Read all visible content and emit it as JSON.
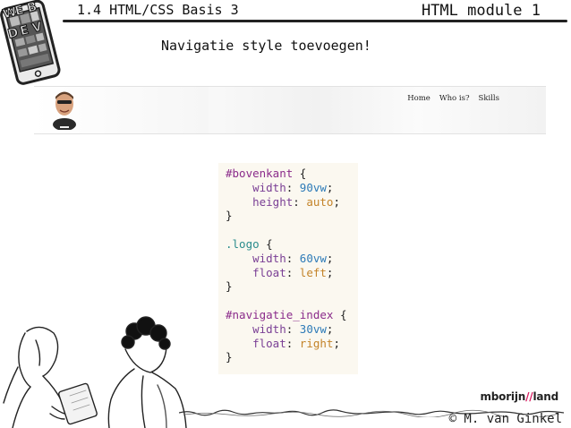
{
  "header": {
    "course_title": "1.4 HTML/CSS Basis 3",
    "module_title": "HTML module 1",
    "logo_letters": [
      "W",
      "E",
      "B",
      "D",
      "E",
      "V"
    ]
  },
  "slide": {
    "title": "Navigatie style toevoegen!"
  },
  "site_preview": {
    "nav_items": [
      "Home",
      "Who is?",
      "Skills"
    ]
  },
  "code": {
    "lines": [
      [
        {
          "t": "#bovenkant",
          "c": "sel"
        },
        {
          "t": " {",
          "c": ""
        }
      ],
      [
        {
          "t": "    width",
          "c": "prop"
        },
        {
          "t": ": ",
          "c": ""
        },
        {
          "t": "90vw",
          "c": "num"
        },
        {
          "t": ";",
          "c": ""
        }
      ],
      [
        {
          "t": "    height",
          "c": "prop"
        },
        {
          "t": ": ",
          "c": ""
        },
        {
          "t": "auto",
          "c": "kw"
        },
        {
          "t": ";",
          "c": ""
        }
      ],
      [
        {
          "t": "}",
          "c": ""
        }
      ],
      [
        {
          "t": "",
          "c": ""
        }
      ],
      [
        {
          "t": ".logo",
          "c": "cls"
        },
        {
          "t": " {",
          "c": ""
        }
      ],
      [
        {
          "t": "    width",
          "c": "prop"
        },
        {
          "t": ": ",
          "c": ""
        },
        {
          "t": "60vw",
          "c": "num"
        },
        {
          "t": ";",
          "c": ""
        }
      ],
      [
        {
          "t": "    float",
          "c": "prop"
        },
        {
          "t": ": ",
          "c": ""
        },
        {
          "t": "left",
          "c": "kw"
        },
        {
          "t": ";",
          "c": ""
        }
      ],
      [
        {
          "t": "}",
          "c": ""
        }
      ],
      [
        {
          "t": "",
          "c": ""
        }
      ],
      [
        {
          "t": "#navigatie_index",
          "c": "sel"
        },
        {
          "t": " {",
          "c": ""
        }
      ],
      [
        {
          "t": "    width",
          "c": "prop"
        },
        {
          "t": ": ",
          "c": ""
        },
        {
          "t": "30vw",
          "c": "num"
        },
        {
          "t": ";",
          "c": ""
        }
      ],
      [
        {
          "t": "    float",
          "c": "prop"
        },
        {
          "t": ": ",
          "c": ""
        },
        {
          "t": "right",
          "c": "kw"
        },
        {
          "t": ";",
          "c": ""
        }
      ],
      [
        {
          "t": "}",
          "c": ""
        }
      ]
    ]
  },
  "footer": {
    "brand_part1": "mbo",
    "brand_part2": "rijn",
    "brand_sep": "//",
    "brand_part3": "land",
    "author": "© M. van Ginkel"
  }
}
